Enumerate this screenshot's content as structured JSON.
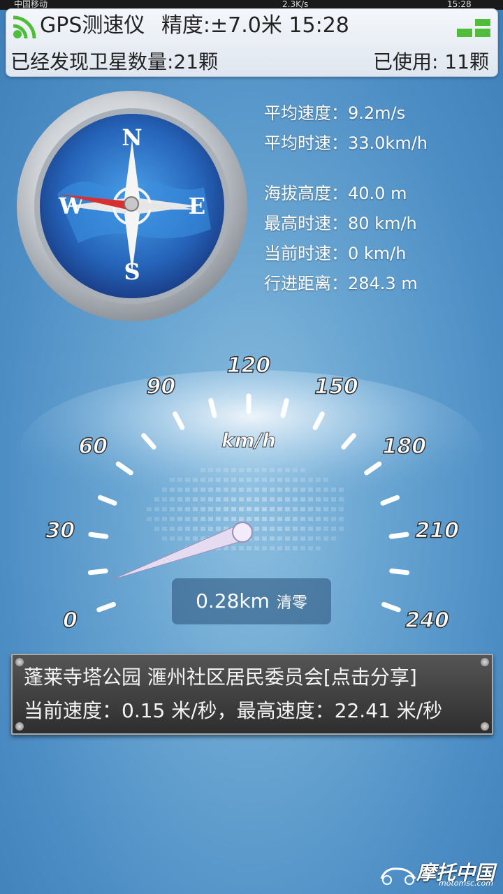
{
  "status_bar": {
    "carrier": "中国移动",
    "net_speed": "2.3K/s",
    "time": "15:28"
  },
  "header": {
    "app_name": "GPS测速仪",
    "accuracy": "精度:±7.0米 15:28",
    "satellites_found": "已经发现卫星数量:21颗",
    "satellites_used": "已使用: 11颗"
  },
  "compass": {
    "north": "N",
    "south": "S",
    "east": "E",
    "west": "W",
    "heading_deg": 270
  },
  "stats": {
    "avg_speed": "平均速度：9.2m/s",
    "avg_hour_speed": "平均时速：33.0km/h",
    "altitude": "海拔高度：40.0 m",
    "max_hour_speed": "最高时速：80 km/h",
    "current_hour_speed": "当前时速：0 km/h",
    "distance": "行进距离：284.3 m"
  },
  "gauge": {
    "unit": "km/h",
    "min": 0,
    "max": 240,
    "labels": [
      "0",
      "30",
      "60",
      "90",
      "120",
      "150",
      "180",
      "210",
      "240"
    ],
    "current_value": 0
  },
  "trip": {
    "distance": "0.28km",
    "clear_label": "清零"
  },
  "location_panel": {
    "address": "蓬莱寺塔公园 滙州社区居民委员会[点击分享]",
    "speed_line": "当前速度：0.15 米/秒，最高速度：22.41 米/秒"
  },
  "watermark": {
    "name": "摩托中国",
    "url": "motomsc.com"
  },
  "colors": {
    "accent_green": "#4fbd3a",
    "needle": "#e6dcf2",
    "compass_red": "#d83030"
  }
}
